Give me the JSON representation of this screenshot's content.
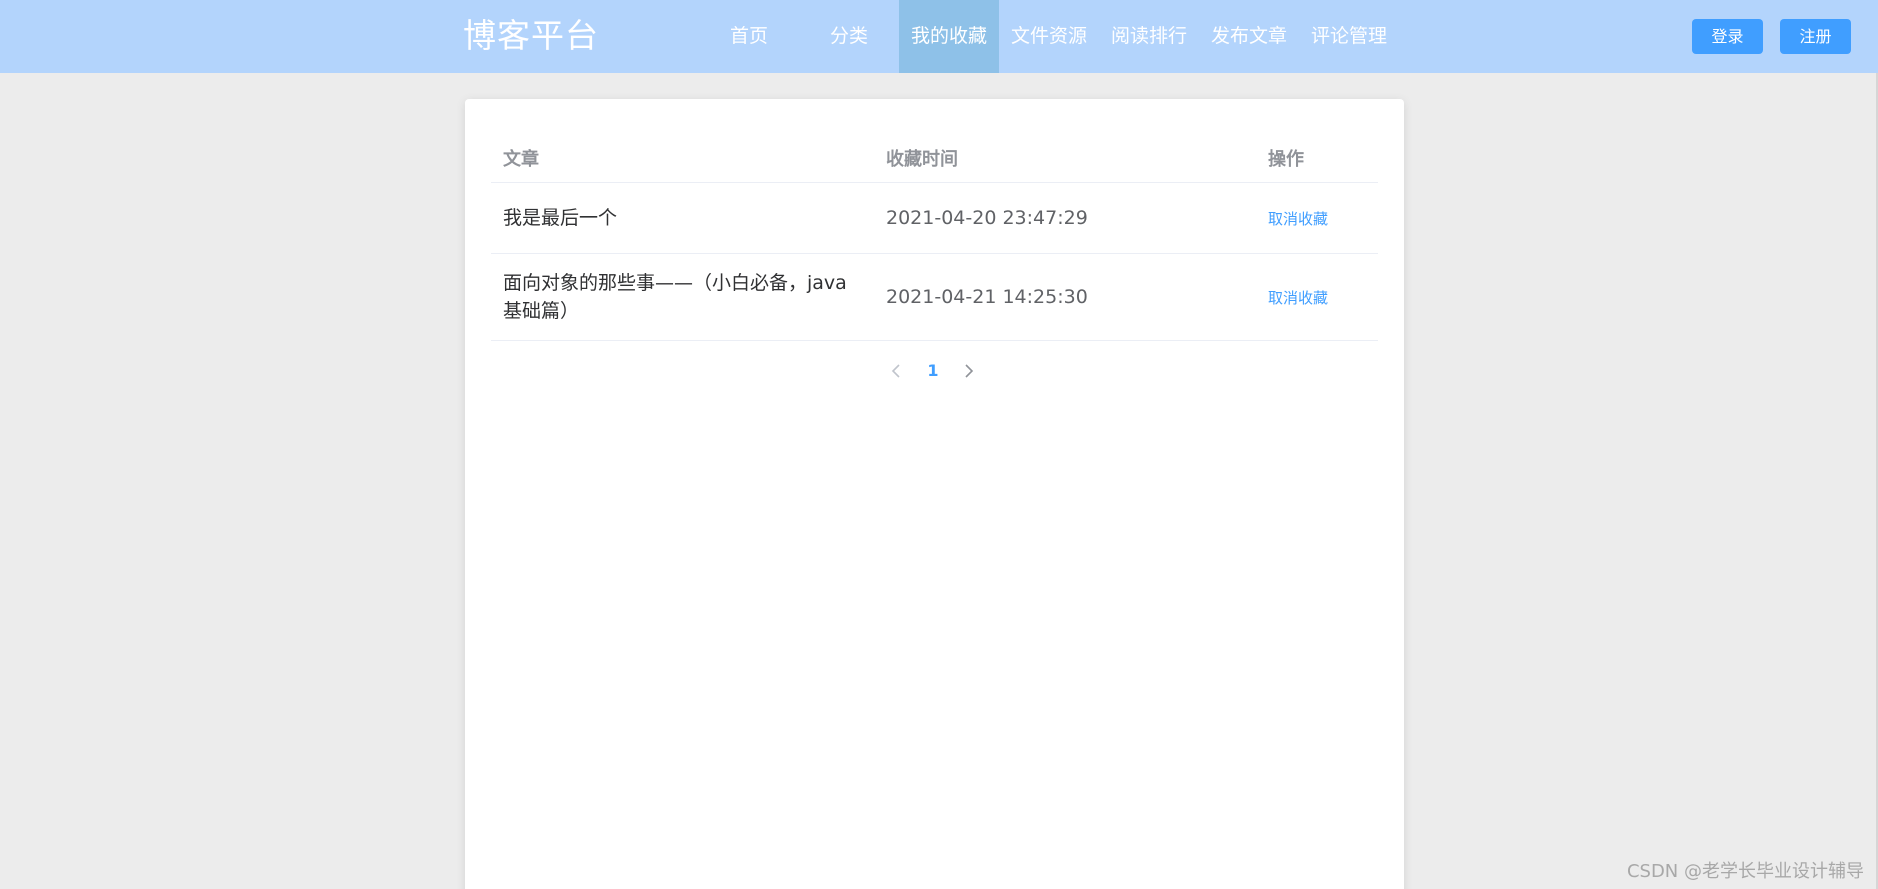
{
  "navbar": {
    "brand": "博客平台",
    "items": [
      {
        "label": "首页",
        "active": false
      },
      {
        "label": "分类",
        "active": false
      },
      {
        "label": "我的收藏",
        "active": true
      },
      {
        "label": "文件资源",
        "active": false
      },
      {
        "label": "阅读排行",
        "active": false
      },
      {
        "label": "发布文章",
        "active": false
      },
      {
        "label": "评论管理",
        "active": false
      }
    ],
    "login_label": "登录",
    "register_label": "注册"
  },
  "favorites": {
    "columns": [
      "文章",
      "收藏时间",
      "操作"
    ],
    "rows": [
      {
        "title": "我是最后一个",
        "time": "2021-04-20 23:47:29",
        "action": "取消收藏"
      },
      {
        "title": "面向对象的那些事——（小白必备，java基础篇）",
        "time": "2021-04-21 14:25:30",
        "action": "取消收藏"
      }
    ]
  },
  "pagination": {
    "prev_icon": "chevron-left-icon",
    "current_page": "1",
    "next_icon": "chevron-right-icon"
  },
  "watermark": "CSDN @老学长毕业设计辅导",
  "colors": {
    "navbar_bg": "#b3d4fc",
    "nav_active_bg": "#8ec1e8",
    "primary": "#409eff",
    "page_bg": "#ececec"
  }
}
